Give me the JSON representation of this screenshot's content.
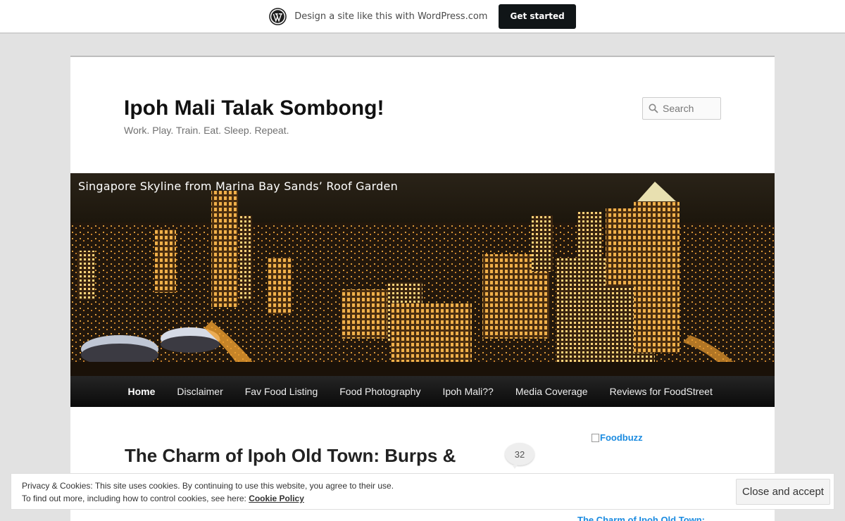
{
  "wpbar": {
    "promo_text": "Design a site like this with WordPress.com",
    "cta_label": "Get started",
    "logo_icon": "wordpress-logo-icon"
  },
  "site": {
    "title": "Ipoh Mali Talak Sombong!",
    "tagline": "Work. Play. Train. Eat. Sleep. Repeat."
  },
  "search": {
    "placeholder": "Search",
    "icon": "search-icon"
  },
  "header": {
    "caption": "Singapore Skyline from Marina Bay Sands’ Roof Garden"
  },
  "nav": {
    "items": [
      {
        "label": "Home",
        "active": true
      },
      {
        "label": "Disclaimer"
      },
      {
        "label": "Fav Food Listing"
      },
      {
        "label": "Food Photography"
      },
      {
        "label": "Ipoh Mali??"
      },
      {
        "label": "Media Coverage"
      },
      {
        "label": "Reviews for FoodStreet"
      }
    ]
  },
  "post": {
    "title": "The Charm of Ipoh Old Town: Burps & Giggles",
    "comment_count": "32"
  },
  "sidebar": {
    "foodbuzz_alt": "Foodbuzz",
    "recent_post_link": "The Charm of Ipoh Old Town:"
  },
  "cookie": {
    "line1": "Privacy & Cookies: This site uses cookies. By continuing to use this website, you agree to their use.",
    "line2_prefix": "To find out more, including how to control cookies, see here: ",
    "policy_link": "Cookie Policy",
    "accept_label": "Close and accept"
  },
  "colors": {
    "link": "#1b8be0",
    "nav_bg": "#111111",
    "page_bg": "#e2e2e2"
  }
}
